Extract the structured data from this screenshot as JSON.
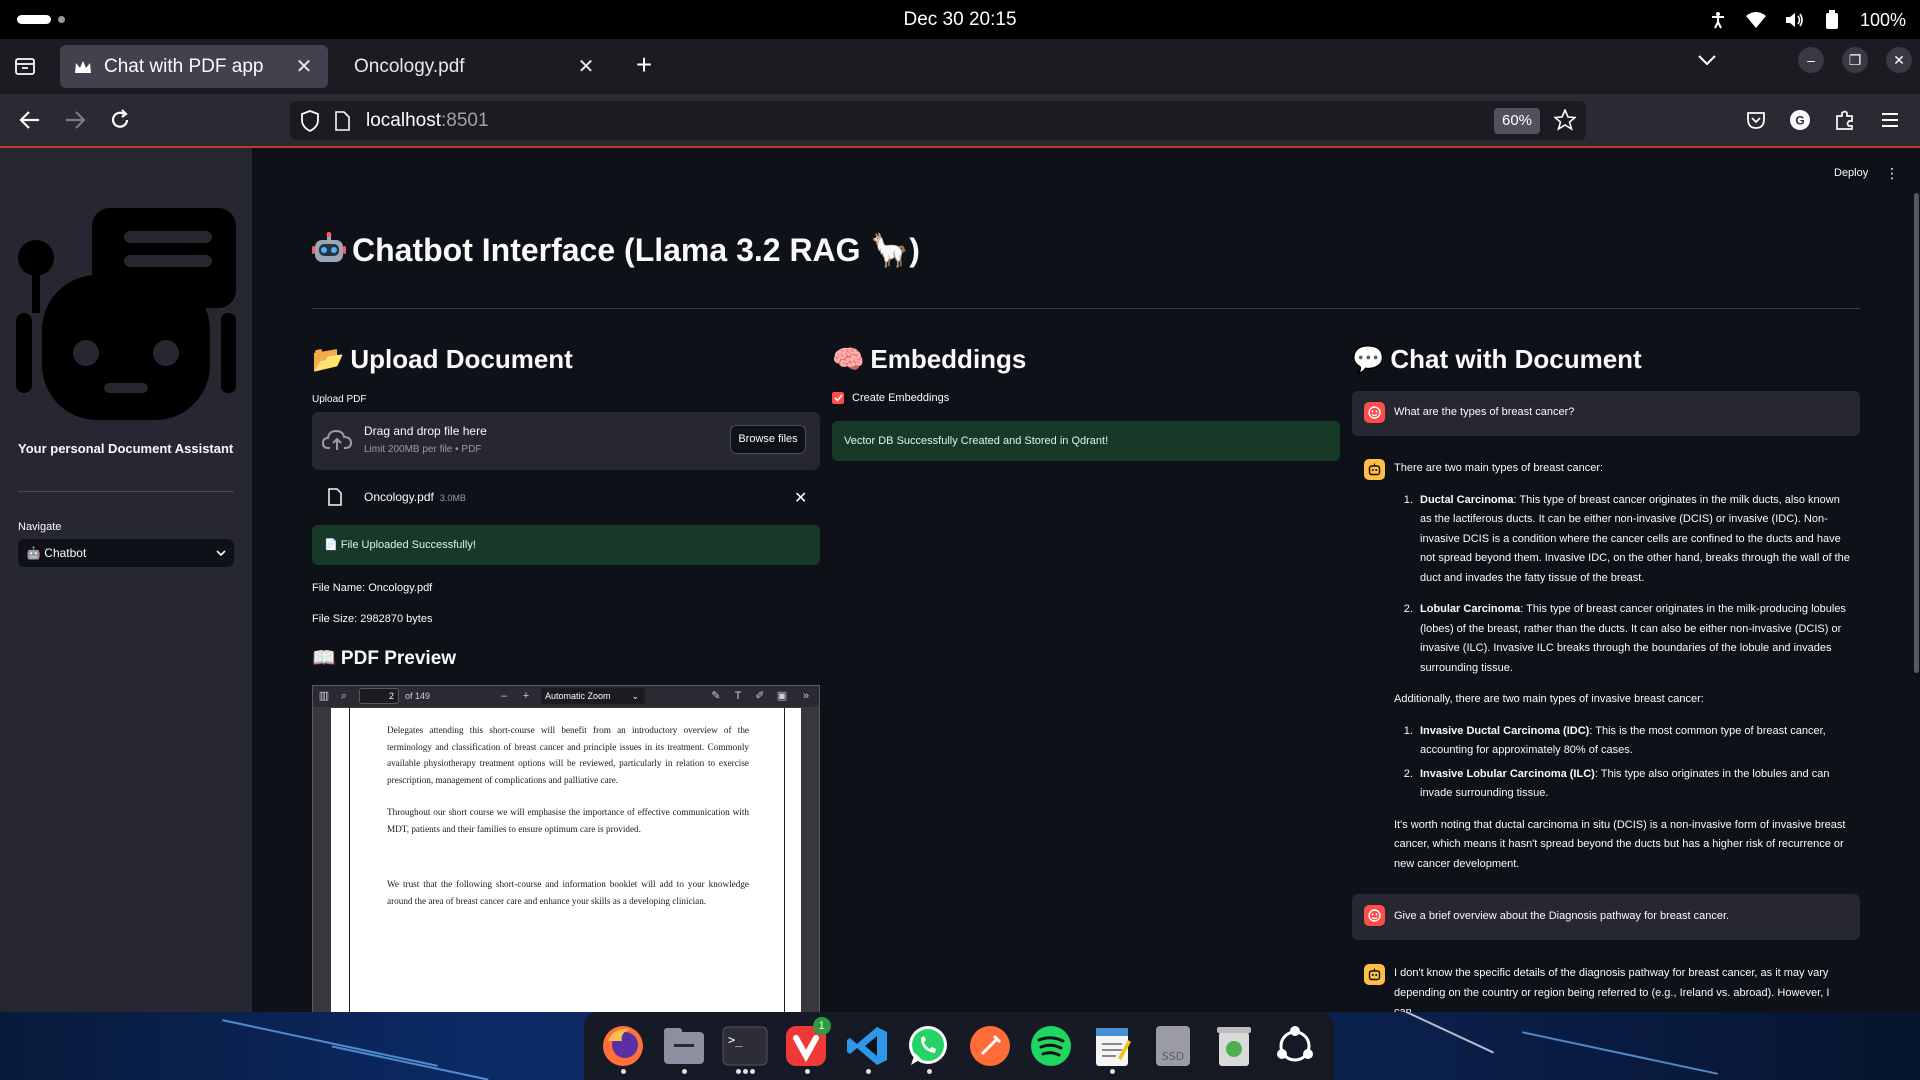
{
  "os": {
    "clock": "Dec 30  20:15",
    "battery": "100%"
  },
  "browser": {
    "tabs": [
      {
        "title": "Chat with PDF app",
        "active": true
      },
      {
        "title": "Oncology.pdf",
        "active": false
      }
    ],
    "url_host": "localhost",
    "url_port": ":8501",
    "zoom": "60%"
  },
  "sidebar": {
    "caption": "Your personal Document Assistant",
    "navigate_label": "Navigate",
    "navigate_value": "🤖 Chatbot"
  },
  "header": {
    "deploy": "Deploy",
    "title": "Chatbot Interface (Llama 3.2 RAG 🦙)",
    "title_icon": "robot-emoji"
  },
  "upload": {
    "header": "Upload Document",
    "header_icon": "📂",
    "label": "Upload PDF",
    "drop_text": "Drag and drop file here",
    "drop_limit": "Limit 200MB per file • PDF",
    "browse_label": "Browse files",
    "file_name": "Oncology.pdf",
    "file_size": "3.0MB",
    "success": "📄 File Uploaded Successfully!",
    "file_name_line": "File Name: Oncology.pdf",
    "file_size_line": "File Size: 2982870 bytes",
    "preview_title": "📖 PDF Preview"
  },
  "pdf_viewer": {
    "page": "2",
    "of_pages": "of 149",
    "zoom": "Automatic Zoom",
    "paragraphs": [
      "Delegates attending this short-course will benefit from an introductory overview of the terminology and classification of breast cancer and principle issues in its treatment. Commonly available physiotherapy treatment options will be reviewed, particularly in relation to exercise prescription, management of complications and palliative care.",
      "Throughout our short course we will emphasise the importance of effective communication with MDT, patients and their families to ensure optimum care is provided.",
      "We trust that the following short-course and information booklet will add to your knowledge around the area of breast cancer care and enhance your skills as a developing clinician."
    ]
  },
  "embeddings": {
    "header": "Embeddings",
    "header_icon": "🧠",
    "checkbox_label": "Create Embeddings",
    "checked": true,
    "success": "Vector DB Successfully Created and Stored in Qdrant!"
  },
  "chat": {
    "header": "Chat with Document",
    "header_icon": "💬",
    "q1": "What are the types of breast cancer?",
    "a1": {
      "intro": "There are two main types of breast cancer:",
      "list1": [
        {
          "bold": "Ductal Carcinoma",
          "text": ": This type of breast cancer originates in the milk ducts, also known as the lactiferous ducts. It can be either non-invasive (DCIS) or invasive (IDC). Non-invasive DCIS is a condition where the cancer cells are confined to the ducts and have not spread beyond them. Invasive IDC, on the other hand, breaks through the wall of the duct and invades the fatty tissue of the breast."
        },
        {
          "bold": "Lobular Carcinoma",
          "text": ": This type of breast cancer originates in the milk-producing lobules (lobes) of the breast, rather than the ducts. It can also be either non-invasive (DCIS) or invasive (ILC). Invasive ILC breaks through the boundaries of the lobule and invades surrounding tissue."
        }
      ],
      "middle": "Additionally, there are two main types of invasive breast cancer:",
      "list2": [
        {
          "bold": "Invasive Ductal Carcinoma (IDC)",
          "text": ": This is the most common type of breast cancer, accounting for approximately 80% of cases."
        },
        {
          "bold": "Invasive Lobular Carcinoma (ILC)",
          "text": ": This type also originates in the lobules and can invade surrounding tissue."
        }
      ],
      "outro": "It's worth noting that ductal carcinoma in situ (DCIS) is a non-invasive form of invasive breast cancer, which means it hasn't spread beyond the ducts but has a higher risk of recurrence or new cancer development."
    },
    "q2": "Give a brief overview about the Diagnosis pathway for breast cancer.",
    "a2": "I don't know the specific details of the diagnosis pathway for breast cancer, as it may vary depending on the country or region being referred to (e.g., Ireland vs. abroad). However, I can"
  },
  "dock": {
    "apps": [
      "firefox-icon",
      "files-icon",
      "terminal-icon",
      "vivaldi-icon",
      "vscode-icon",
      "whatsapp-icon",
      "postman-icon",
      "spotify-icon",
      "text-editor-icon",
      "disk-icon",
      "trash-icon",
      "show-apps-icon"
    ],
    "vivaldi_badge": "1"
  },
  "colors": {
    "accent_red": "#ff4b4b",
    "success_bg": "#173928",
    "sidebar_bg": "#262730",
    "app_bg": "#0e1117"
  }
}
